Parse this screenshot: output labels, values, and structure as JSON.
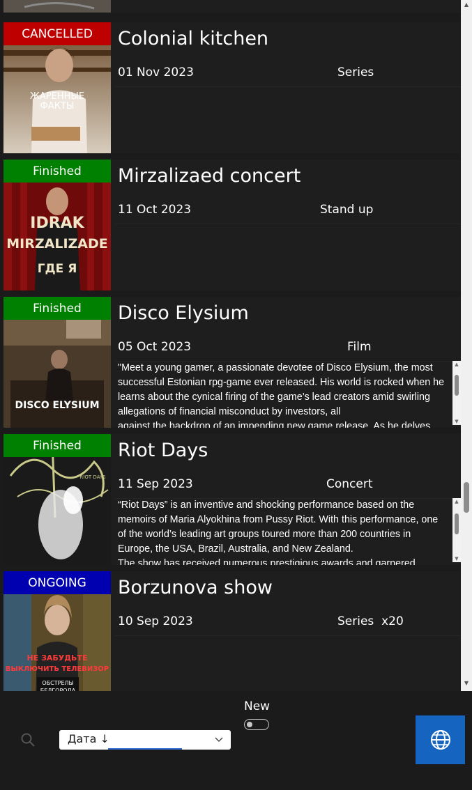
{
  "list": {
    "items": [
      {
        "status": "CANCELLED",
        "status_color": "#bf0000",
        "title": "Colonial kitchen",
        "date": "01 Nov 2023",
        "genre": "Series",
        "poster_text": "ЖАРЕННЫЕ\nФАКТЫ",
        "description": ""
      },
      {
        "status": "Finished",
        "status_color": "#008000",
        "title": "Mirzalizaed concert",
        "date": "11 Oct 2023",
        "genre": "Stand up",
        "poster_text_1": "IDRAK",
        "poster_text_2": "MIRZALIZADE",
        "poster_text_3": "ГДЕ Я",
        "description": ""
      },
      {
        "status": "Finished",
        "status_color": "#008000",
        "title": "Disco Elysium",
        "date": "05 Oct 2023",
        "genre": "Film",
        "poster_text": "DISCO ELYSIUM",
        "description": "\"Meet a young gamer, a passionate devotee of Disco Elysium, the most successful Estonian rpg-game ever released. His world is rocked when he learns about the cynical firing of the game’s lead creators amid swirling allegations of financial misconduct by investors, all\nagainst the backdrop of an impending new game release. As he delves"
      },
      {
        "status": "Finished",
        "status_color": "#008000",
        "title": "Riot Days",
        "date": "11 Sep 2023",
        "genre": "Concert",
        "poster_text": "RIOT DAYS",
        "description": "“Riot Days” is an inventive and shocking performance based on the memoirs of Maria Alyokhina from Pussy Riot. With this performance, one of the world’s leading art groups toured more than 200 countries in Europe, the USA, Brazil, Australia, and New Zealand.\nThe show has received numerous prestigious awards and garnered"
      },
      {
        "status": "ONGOING",
        "status_color": "#0000b0",
        "title": "Borzunova show",
        "date": "10 Sep 2023",
        "genre": "Series  x20",
        "poster_text_1": "НЕ ЗАБУДЬТЕ",
        "poster_text_2": "ВЫКЛЮЧИТЬ ТЕЛЕВИЗОР",
        "poster_text_3": "ОБСТРЕЛЫ",
        "poster_text_4": "БЕЛГОРОДА",
        "description": ""
      }
    ]
  },
  "toolbar": {
    "sort_value": "Дата ↓",
    "new_label": "New",
    "new_toggle_on": false
  },
  "icons": {
    "search": "search-icon",
    "chevron": "chevron-down-icon",
    "globe": "globe-icon"
  },
  "colors": {
    "accent": "#1565c0",
    "background": "#1b1b1b"
  }
}
